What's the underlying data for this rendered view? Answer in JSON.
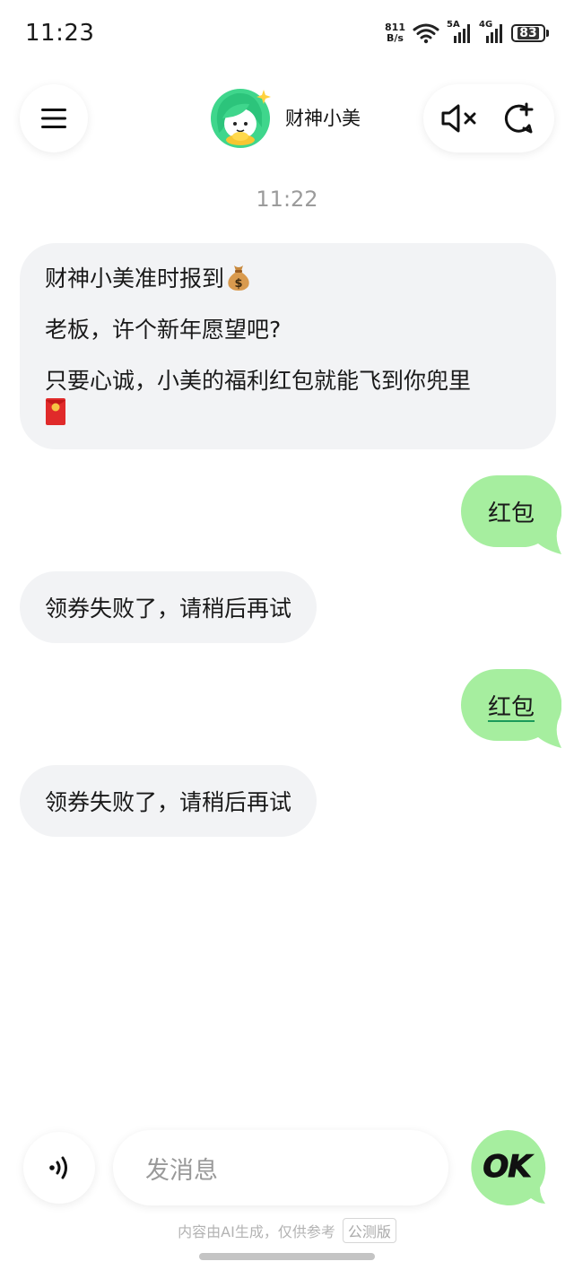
{
  "status_bar": {
    "time": "11:23",
    "net_speed_value": "811",
    "net_speed_unit": "B/s",
    "signal1_label": "5A",
    "signal2_label": "4G",
    "battery": "83"
  },
  "header": {
    "title": "财神小美",
    "icons": [
      "menu-icon",
      "mute-icon",
      "new-chat-icon"
    ]
  },
  "chat": {
    "timestamp": "11:22",
    "messages": [
      {
        "side": "left",
        "lines": [
          "财神小美准时报到",
          "老板，许个新年愿望吧?",
          "只要心诚，小美的福利红包就能飞到你兜里"
        ],
        "emojis": [
          "money-bag-icon",
          "red-envelope-icon"
        ]
      },
      {
        "side": "right",
        "text": "红包"
      },
      {
        "side": "left",
        "text": "领券失败了，请稍后再试"
      },
      {
        "side": "right",
        "text": "红包"
      },
      {
        "side": "left",
        "text": "领券失败了，请稍后再试"
      }
    ]
  },
  "input": {
    "placeholder": "发消息",
    "send_label": "OK"
  },
  "footer": {
    "note": "内容由AI生成，仅供参考",
    "badge": "公测版"
  },
  "colors": {
    "user_bubble": "#a6ee9f",
    "bot_bubble": "#f2f3f5",
    "timestamp": "#9b9b9b",
    "placeholder": "#999999"
  }
}
